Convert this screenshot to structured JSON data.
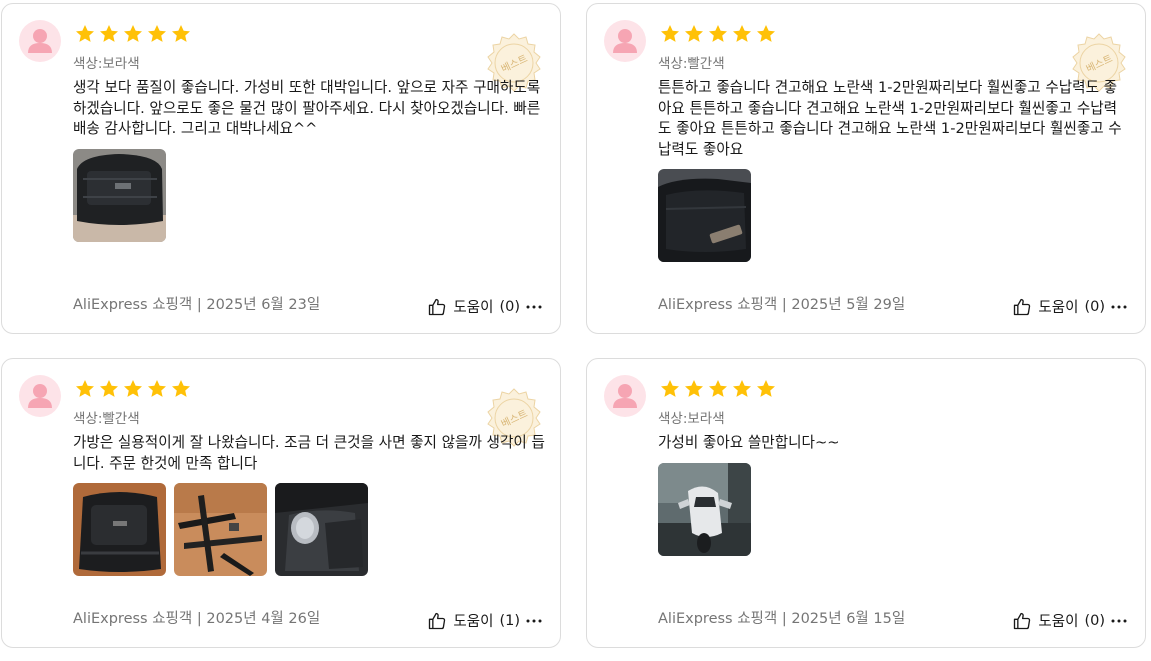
{
  "reviews": [
    {
      "rating": 5,
      "sku": "색상:보라색",
      "badge": "베스트",
      "text": "생각 보다 품질이 좋습니다. 가성비 또한 대박입니다. 앞으로 자주 구매하도록 하겠습니다. 앞으로도 좋은 물건 많이 팔아주세요. 다시 찾아오겠습니다. 빠른배송 감사합니다. 그리고 대박나세요^^",
      "author": "AliExpress 쇼핑객",
      "date": "2025년 6월 23일",
      "helpful_label": "도움이",
      "helpful_count": "(0)",
      "photos": [
        "black-bag-photo"
      ]
    },
    {
      "rating": 5,
      "sku": "색상:빨간색",
      "badge": "베스트",
      "text": "튼튼하고 좋습니다 견고해요 노란색 1-2만원짜리보다 훨씬좋고 수납력도 좋아요 튼튼하고 좋습니다 견고해요 노란색 1-2만원짜리보다 훨씬좋고 수납력도 좋아요 튼튼하고 좋습니다 견고해요 노란색 1-2만원짜리보다 훨씬좋고 수납력도 좋아요",
      "author": "AliExpress 쇼핑객",
      "date": "2025년 5월 29일",
      "helpful_label": "도움이",
      "helpful_count": "(0)",
      "photos": [
        "black-bag-photo"
      ]
    },
    {
      "rating": 5,
      "sku": "색상:빨간색",
      "badge": "베스트",
      "text": "가방은 실용적이게 잘 나왔습니다. 조금 더 큰것을 사면 좋지 않을까 생각이 듭니다. 주문 한것에 만족 합니다",
      "author": "AliExpress 쇼핑객",
      "date": "2025년 4월 26일",
      "helpful_label": "도움이",
      "helpful_count": "(1)",
      "photos": [
        "black-bag-photo",
        "straps-photo",
        "bag-interior-photo"
      ]
    },
    {
      "rating": 5,
      "sku": "색상:보라색",
      "badge": "",
      "text": "가성비 좋아요 쓸만합니다~~",
      "author": "AliExpress 쇼핑객",
      "date": "2025년 6월 15일",
      "helpful_label": "도움이",
      "helpful_count": "(0)",
      "photos": [
        "motorcycle-photo"
      ]
    }
  ],
  "colors": {
    "star": "#ffc107",
    "badge": "#e9c98a",
    "muted_text": "#757575",
    "border": "#dcdcdc",
    "avatar_bg": "#fde3e8",
    "avatar_fg": "#f6a5b3"
  },
  "icons": [
    "user-avatar-icon",
    "star-icon",
    "best-badge-icon",
    "thumbs-up-icon",
    "more-options-icon"
  ]
}
